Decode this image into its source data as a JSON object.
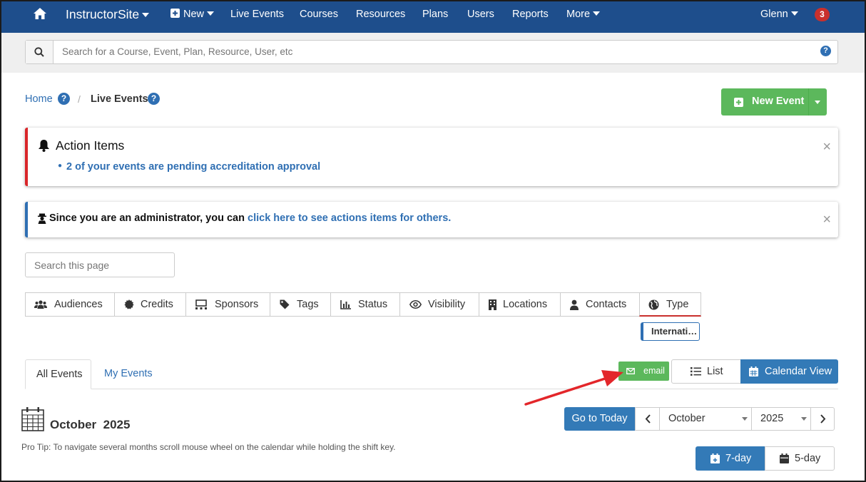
{
  "colors": {
    "navbar": "#1e4e8c",
    "primary": "#337ab7",
    "success": "#5cb85c",
    "danger": "#d9262a",
    "annotation_arrow": "#e3262a"
  },
  "nav": {
    "home_icon": "home-icon",
    "brand": "InstructorSite",
    "new_label": "New",
    "items": [
      "Live Events",
      "Courses",
      "Resources",
      "Plans",
      "Users",
      "Reports"
    ],
    "more_label": "More",
    "user": "Glenn",
    "notification_count": "3"
  },
  "search": {
    "placeholder": "Search for a Course, Event, Plan, Resource, User, etc"
  },
  "breadcrumb": {
    "home": "Home",
    "help": "?",
    "separator": "/",
    "current": "Live Events"
  },
  "new_event_label": "New Event",
  "action_items": {
    "title": "Action Items",
    "items": [
      "2 of your events are pending accreditation approval"
    ],
    "close": "×"
  },
  "admin_notice": {
    "text": "Since you are an administrator, you can",
    "link": "click here to see actions items for others.",
    "close": "×"
  },
  "page_search": {
    "placeholder": "Search this page"
  },
  "filters": [
    {
      "label": "Audiences",
      "icon": "users-icon"
    },
    {
      "label": "Credits",
      "icon": "certificate-icon"
    },
    {
      "label": "Sponsors",
      "icon": "sponsors-icon"
    },
    {
      "label": "Tags",
      "icon": "tag-icon"
    },
    {
      "label": "Status",
      "icon": "bar-chart-icon"
    },
    {
      "label": "Visibility",
      "icon": "eye-icon"
    },
    {
      "label": "Locations",
      "icon": "building-icon"
    },
    {
      "label": "Contacts",
      "icon": "user-icon"
    },
    {
      "label": "Type",
      "icon": "globe-icon"
    }
  ],
  "type_filter_value": "International",
  "event_tabs": {
    "all": "All Events",
    "mine": "My Events"
  },
  "views": {
    "email": "email",
    "list": "List",
    "calendar": "Calendar View"
  },
  "calendar": {
    "month_title": "October  2025",
    "pro_tip": "Pro Tip: To navigate several months scroll mouse wheel on the calendar while holding the shift key.",
    "go_to_today": "Go to Today",
    "prev": "‹",
    "next": "›",
    "month": "October",
    "year": "2025",
    "seven_day": "7-day",
    "five_day": "5-day"
  }
}
